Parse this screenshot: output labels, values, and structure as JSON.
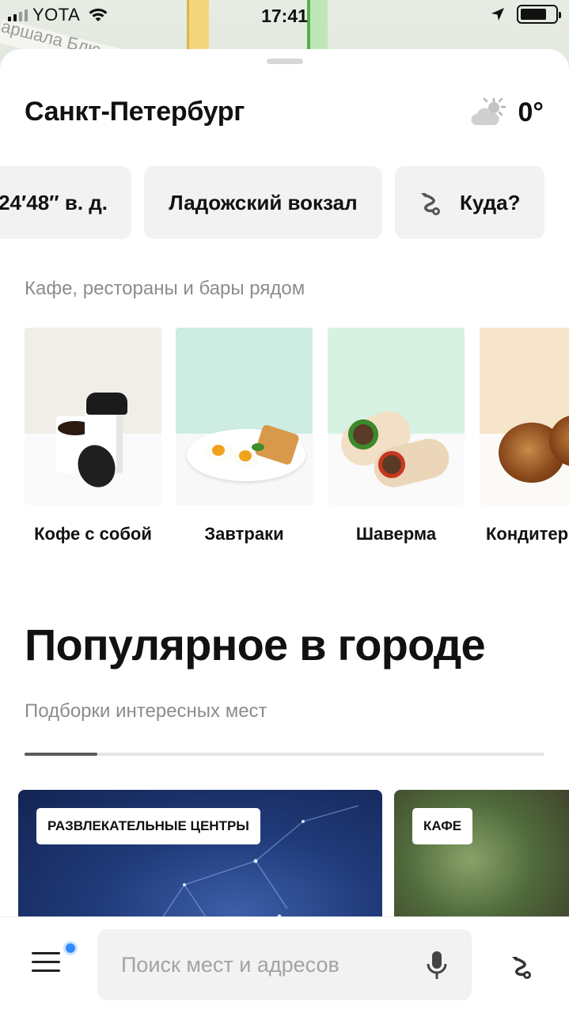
{
  "status_bar": {
    "carrier": "YOTA",
    "time": "17:41",
    "battery_level": 0.75
  },
  "map": {
    "street_label": "аршала Блю"
  },
  "header": {
    "city": "Санкт-Петербург",
    "temperature": "0°",
    "weather_icon": "partly-cloudy-icon"
  },
  "chips": {
    "coords": "24′48″ в. д.",
    "station": "Ладожский вокзал",
    "where": "Куда?"
  },
  "cafes": {
    "title": "Кафе, рестораны и бары рядом",
    "items": [
      {
        "label": "Кофе с собой",
        "bg": "#f0eee7"
      },
      {
        "label": "Завтраки",
        "bg": "#cdece2"
      },
      {
        "label": "Шаверма",
        "bg": "#d7f2e3"
      },
      {
        "label": "Кондитер",
        "bg": "#f6e4cb"
      }
    ]
  },
  "popular": {
    "title": "Популярное в городе",
    "subtitle": "Подборки интересных мест",
    "progress": 0.14,
    "cards": [
      {
        "tag": "РАЗВЛЕКАТЕЛЬНЫЕ ЦЕНТРЫ"
      },
      {
        "tag": "КАФЕ"
      }
    ]
  },
  "search": {
    "placeholder": "Поиск мест и адресов"
  },
  "colors": {
    "accent_blue": "#2f8bff",
    "chip_bg": "#f2f2f2",
    "muted_text": "#8c8c8c"
  }
}
